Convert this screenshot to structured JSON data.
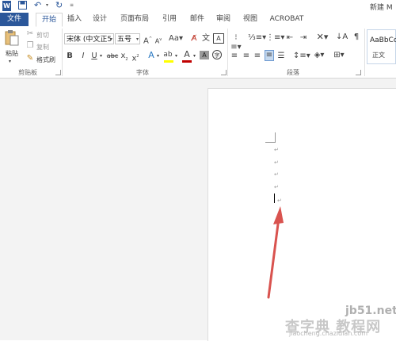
{
  "title_bar": {
    "doc_title": "新建 M"
  },
  "tabs": [
    {
      "label": "文件",
      "active_file": true
    },
    {
      "label": "开始",
      "selected": true
    },
    {
      "label": "插入"
    },
    {
      "label": "设计"
    },
    {
      "label": "页面布局"
    },
    {
      "label": "引用"
    },
    {
      "label": "邮件"
    },
    {
      "label": "审阅"
    },
    {
      "label": "视图"
    },
    {
      "label": "ACROBAT"
    }
  ],
  "clipboard": {
    "paste_label": "粘贴",
    "cut_label": "剪切",
    "copy_label": "复制",
    "format_painter_label": "格式刷",
    "group_label": "剪贴板"
  },
  "font": {
    "font_name": "宋体 (中文正5",
    "font_size": "五号",
    "group_label": "字体"
  },
  "paragraph": {
    "group_label": "段落"
  },
  "styles": {
    "preview": "AaBbCc",
    "normal_label": "正文"
  },
  "document": {
    "paragraph_mark": "↵"
  },
  "watermark": {
    "site": "jb51.net",
    "text": "查字典 教程网",
    "url": "jiaocheng.chazidian.com"
  },
  "colors": {
    "file_tab": "#2b579a",
    "accent": "#2b579a",
    "arrow": "#d9534f",
    "highlight": "#ffff00",
    "font_color": "#c00000"
  }
}
